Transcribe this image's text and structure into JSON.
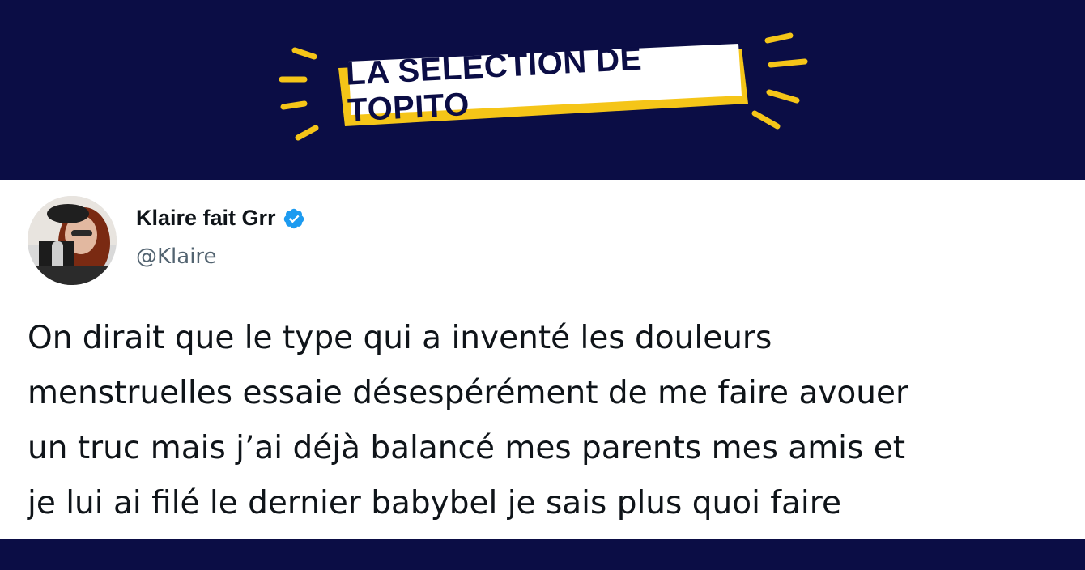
{
  "banner": {
    "title": "LA SÉLECTION DE TOPITO",
    "colors": {
      "background": "#0b0d45",
      "accent": "#f5c518",
      "label_bg": "#ffffff",
      "label_text": "#0b0d45"
    }
  },
  "tweet": {
    "author": {
      "display_name": "Klaire fait Grr",
      "handle": "@Klaire",
      "verified": true,
      "avatar_icon": "avatar-photo"
    },
    "text_lines": [
      "On dirait que le type qui a inventé les douleurs",
      "menstruelles essaie désespérément de me faire avouer",
      "un truc mais j’ai déjà balancé mes parents mes amis et",
      "je lui ai filé le dernier babybel je sais plus quoi faire"
    ],
    "colors": {
      "text": "#0f1419",
      "handle": "#536471",
      "verified": "#1d9bf0"
    }
  }
}
